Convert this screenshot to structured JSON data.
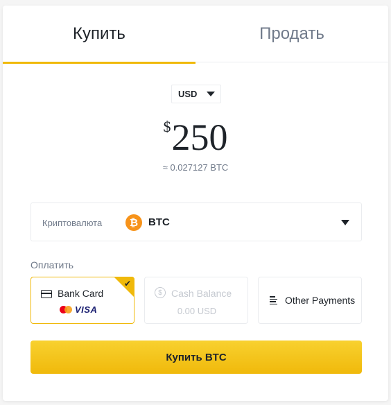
{
  "tabs": {
    "buy": "Купить",
    "sell": "Продать"
  },
  "fiat": {
    "currency": "USD",
    "symbol": "$",
    "amount": "250"
  },
  "conversion": "≈ 0.027127 BTC",
  "crypto": {
    "label": "Криптовалюта",
    "coin": "BTC",
    "icon_glyph": "₿"
  },
  "payment": {
    "label": "Оплатить",
    "options": [
      {
        "title": "Bank Card",
        "brands": {
          "visa": "VISA"
        },
        "selected": true,
        "check": "✔"
      },
      {
        "title": "Cash Balance",
        "balance": "0.00 USD",
        "disabled": true,
        "icon_glyph": "$"
      },
      {
        "title": "Other Payments"
      }
    ]
  },
  "buy_button": "Купить BTC",
  "colors": {
    "accent": "#f0b90b",
    "text": "#1e2329",
    "muted": "#707a8a",
    "disabled": "#c5c9d0",
    "btc": "#f7931a"
  }
}
